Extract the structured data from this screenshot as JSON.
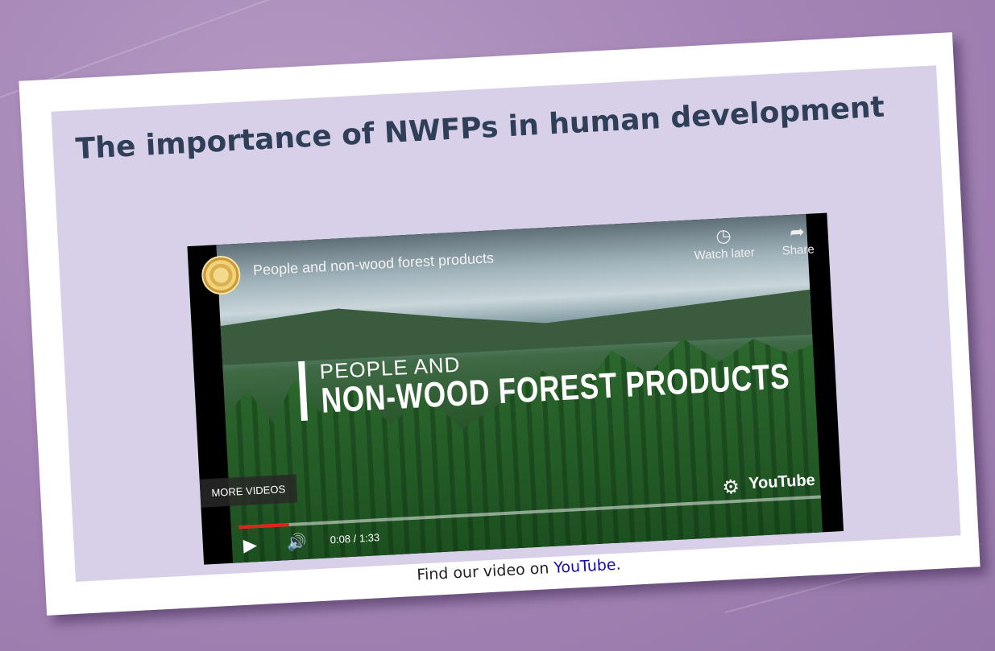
{
  "page": {
    "heading": "The importance of NWFPs in human development",
    "caption_prefix": "Find our video on ",
    "caption_link": "YouTube",
    "caption_suffix": "."
  },
  "player": {
    "video_title": "People and non-wood forest products",
    "watch_later_label": "Watch later",
    "share_label": "Share",
    "overlay_line1": "PEOPLE AND",
    "overlay_line2": "NON-WOOD FOREST PRODUCTS",
    "more_videos_label": "MORE VIDEOS",
    "time_display": "0:08 / 1:33",
    "progress_fraction": 0.086,
    "brand_label": "YouTube",
    "icons": {
      "clock": "clock-icon",
      "share": "share-arrow-icon",
      "play": "play-icon",
      "volume": "volume-icon",
      "settings": "gear-icon"
    }
  },
  "colors": {
    "background": "#a585b6",
    "panel": "#d8d0e9",
    "heading": "#2f3f57",
    "progress": "#e62117",
    "link": "#1a0dab"
  }
}
